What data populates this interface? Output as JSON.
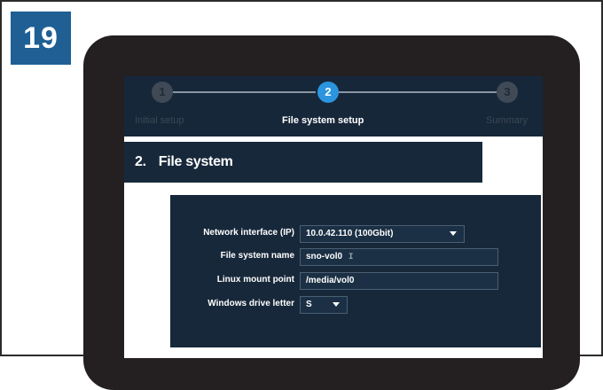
{
  "badge": {
    "number": "19"
  },
  "wizard": {
    "steps": [
      {
        "number": "1",
        "label": "Initial setup",
        "state": "inactive"
      },
      {
        "number": "2",
        "label": "File system setup",
        "state": "active"
      },
      {
        "number": "3",
        "label": "Summary",
        "state": "inactive"
      }
    ]
  },
  "section": {
    "number": "2.",
    "title": "File system"
  },
  "form": {
    "network_interface": {
      "label": "Network interface (IP)",
      "value": "10.0.42.110 (100Gbit)"
    },
    "file_system_name": {
      "label": "File system name",
      "value": "sno-vol0"
    },
    "linux_mount_point": {
      "label": "Linux mount point",
      "value": "/media/vol0"
    },
    "windows_drive_letter": {
      "label": "Windows drive letter",
      "value": "S"
    }
  },
  "colors": {
    "badge_blue": "#1f5f94",
    "tablet_bezel": "#242021",
    "panel_navy": "#17283a",
    "active_step": "#2b95e0"
  }
}
